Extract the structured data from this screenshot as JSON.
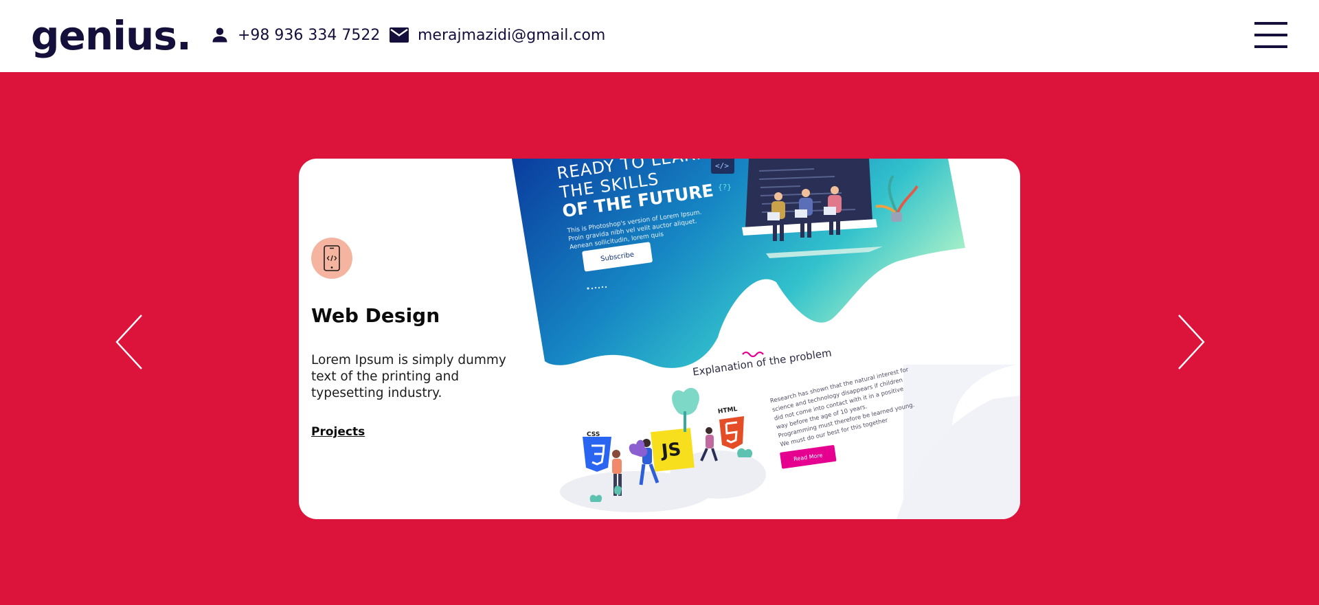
{
  "header": {
    "logo": "genius.",
    "phone_icon": "person-icon",
    "phone": "+98 936 334 7522",
    "email_icon": "envelope-icon",
    "email": "merajmazidi@gmail.com",
    "menu_icon": "hamburger-menu-icon"
  },
  "slider": {
    "prev_icon": "chevron-left-icon",
    "next_icon": "chevron-right-icon",
    "card": {
      "icon": "mobile-code-icon",
      "title": "Web Design",
      "description": "Lorem Ipsum is simply dummy text of the printing and typesetting industry.",
      "link": "Projects",
      "illustration": {
        "headline_1": "READY TO LEARN",
        "headline_2": "THE SKILLS",
        "headline_3": "OF THE FUTURE",
        "paragraph_1": "This is Photoshop's version of Lorem Ipsum.",
        "paragraph_2": "Proin gravida nibh vel velit auctor aliquet.",
        "paragraph_3": "Aenean sollicitudin, lorem quis",
        "subscribe_label": "Subscribe",
        "section_title": "Explanation of the problem",
        "research_1": "Research has shown that the natural interest for",
        "research_2": "science and technology disappears if children",
        "research_3": "did not come into contact with it in a positive",
        "research_4": "way before the age of 10 years.",
        "research_5": "Programming must therefore be learned young.",
        "research_6": "We must do our best for this together",
        "read_more_label": "Read More",
        "badge_css": "CSS",
        "badge_js": "JS",
        "badge_html": "HTML"
      }
    }
  },
  "colors": {
    "brand_dark": "#14103b",
    "hero_bg": "#dc143c",
    "icon_circle": "#f4b4a0",
    "gradient_start": "#0a3c9e",
    "gradient_end": "#7fe6c8",
    "read_more": "#e6008f"
  }
}
